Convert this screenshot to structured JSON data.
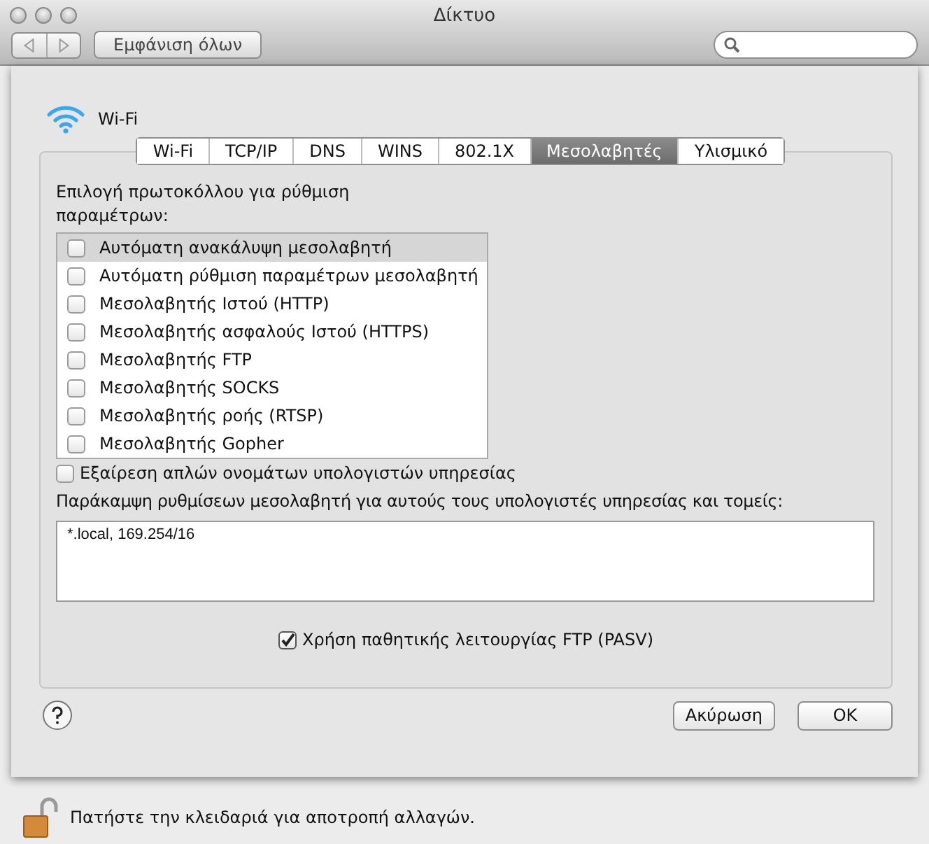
{
  "window": {
    "title": "Δίκτυο"
  },
  "toolbar": {
    "show_all": "Εμφάνιση όλων"
  },
  "service": {
    "name": "Wi-Fi"
  },
  "tabs": [
    {
      "label": "Wi-Fi",
      "selected": false
    },
    {
      "label": "TCP/IP",
      "selected": false
    },
    {
      "label": "DNS",
      "selected": false
    },
    {
      "label": "WINS",
      "selected": false
    },
    {
      "label": "802.1X",
      "selected": false
    },
    {
      "label": "Μεσολαβητές",
      "selected": true
    },
    {
      "label": "Υλισμικό",
      "selected": false
    }
  ],
  "protocols": {
    "label": "Επιλογή πρωτοκόλλου για ρύθμιση παραμέτρων:",
    "items": [
      {
        "label": "Αυτόματη ανακάλυψη μεσολαβητή",
        "checked": false,
        "selected": true
      },
      {
        "label": "Αυτόματη ρύθμιση παραμέτρων μεσολαβητή",
        "checked": false,
        "selected": false
      },
      {
        "label": "Μεσολαβητής Ιστού (HTTP)",
        "checked": false,
        "selected": false
      },
      {
        "label": "Μεσολαβητής ασφαλούς Ιστού (HTTPS)",
        "checked": false,
        "selected": false
      },
      {
        "label": "Μεσολαβητής FTP",
        "checked": false,
        "selected": false
      },
      {
        "label": "Μεσολαβητής SOCKS",
        "checked": false,
        "selected": false
      },
      {
        "label": "Μεσολαβητής ροής (RTSP)",
        "checked": false,
        "selected": false
      },
      {
        "label": "Μεσολαβητής Gopher",
        "checked": false,
        "selected": false
      }
    ]
  },
  "exclude_simple": {
    "label": "Εξαίρεση απλών ονομάτων υπολογιστών υπηρεσίας",
    "checked": false
  },
  "bypass": {
    "label": "Παράκαμψη ρυθμίσεων μεσολαβητή για αυτούς τους υπολογιστές υπηρεσίας και τομείς:",
    "value": "*.local, 169.254/16"
  },
  "passive_ftp": {
    "label": "Χρήση παθητικής λειτουργίας FTP (PASV)",
    "checked": true
  },
  "buttons": [
    {
      "label": "Ακύρωση",
      "kind": "cancel"
    },
    {
      "label": "OK",
      "kind": "ok"
    }
  ],
  "lock": {
    "label": "Πατήστε την κλειδαριά για αποτροπή αλλαγών."
  }
}
